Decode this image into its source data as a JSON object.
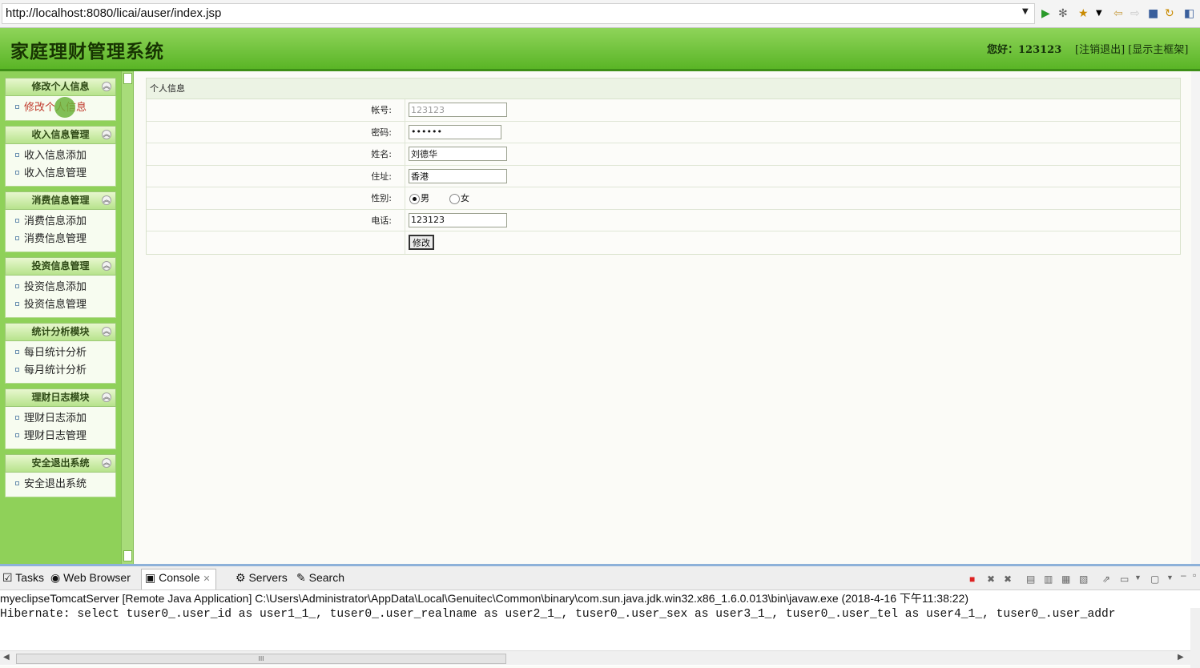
{
  "browser": {
    "url": "http://localhost:8080/licai/auser/index.jsp"
  },
  "header": {
    "title": "家庭理财管理系统",
    "greeting": "您好：123123",
    "links": "[注销退出] [显示主框架]"
  },
  "sidebar": {
    "groups": [
      {
        "title": "修改个人信息",
        "items": [
          "修改个人信息"
        ]
      },
      {
        "title": "收入信息管理",
        "items": [
          "收入信息添加",
          "收入信息管理"
        ]
      },
      {
        "title": "消费信息管理",
        "items": [
          "消费信息添加",
          "消费信息管理"
        ]
      },
      {
        "title": "投资信息管理",
        "items": [
          "投资信息添加",
          "投资信息管理"
        ]
      },
      {
        "title": "统计分析模块",
        "items": [
          "每日统计分析",
          "每月统计分析"
        ]
      },
      {
        "title": "理财日志模块",
        "items": [
          "理财日志添加",
          "理财日志管理"
        ]
      },
      {
        "title": "安全退出系统",
        "items": [
          "安全退出系统"
        ]
      }
    ]
  },
  "form": {
    "panel_title": "个人信息",
    "account_label": "帐号:",
    "account_value": "123123",
    "password_label": "密码:",
    "password_value": "••••••",
    "name_label": "姓名:",
    "name_value": "刘德华",
    "address_label": "住址:",
    "address_value": "香港",
    "sex_label": "性别:",
    "sex_male": "男",
    "sex_female": "女",
    "sex_selected": "男",
    "phone_label": "电话:",
    "phone_value": "123123",
    "submit_label": "修改"
  },
  "console": {
    "tabs": [
      "Tasks",
      "Web Browser",
      "Console",
      "Servers",
      "Search"
    ],
    "active_tab": "Console",
    "launch_line": "myeclipseTomcatServer [Remote Java Application] C:\\Users\\Administrator\\AppData\\Local\\Genuitec\\Common\\binary\\com.sun.java.jdk.win32.x86_1.6.0.013\\bin\\javaw.exe (2018-4-16 下午11:38:22)",
    "output_line": "Hibernate: select tuser0_.user_id as user1_1_, tuser0_.user_realname as user2_1_, tuser0_.user_sex as user3_1_, tuser0_.user_tel as user4_1_, tuser0_.user_addr",
    "scroll_thumb": "III"
  },
  "colors": {
    "header_green": "#5ab526",
    "sidebar_green": "#8fd159",
    "active_item": "#c0392b"
  }
}
